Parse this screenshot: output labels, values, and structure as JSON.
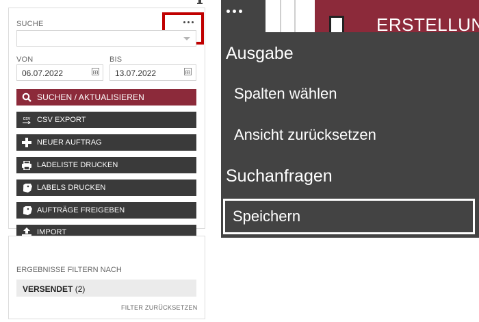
{
  "left_panel": {
    "search_label": "SUCHE",
    "search_value": "",
    "from_label": "VON",
    "to_label": "BIS",
    "from_date": "06.07.2022",
    "to_date": "13.07.2022",
    "buttons": [
      {
        "label": "SUCHEN / AKTUALISIEREN",
        "icon": "search-icon"
      },
      {
        "label": "CSV EXPORT",
        "icon": "csv-icon"
      },
      {
        "label": "NEUER AUFTRAG",
        "icon": "plus-icon"
      },
      {
        "label": "LADELISTE DRUCKEN",
        "icon": "printer-icon"
      },
      {
        "label": "LABELS DRUCKEN",
        "icon": "label-icon"
      },
      {
        "label": "AUFTRÄGE FREIGEBEN",
        "icon": "label-icon"
      },
      {
        "label": "IMPORT",
        "icon": "upload-icon"
      }
    ],
    "csv_icon_text": "csv",
    "filter": {
      "heading": "ERGEBNISSE FILTERN NACH",
      "item_label": "VERSENDET",
      "item_count": "(2)",
      "reset_label": "FILTER ZURÜCKSETZEN"
    }
  },
  "right_panel": {
    "column_header": "ERSTELLUNG",
    "menu": {
      "section_output": "Ausgabe",
      "choose_columns": "Spalten wählen",
      "reset_view": "Ansicht zurücksetzen",
      "section_queries": "Suchanfragen",
      "save": "Speichern"
    }
  },
  "colors": {
    "primary": "#8c2a3a",
    "button_dark": "#3a3a3a",
    "menu_bg": "#434343",
    "highlight_red": "#c00000"
  }
}
